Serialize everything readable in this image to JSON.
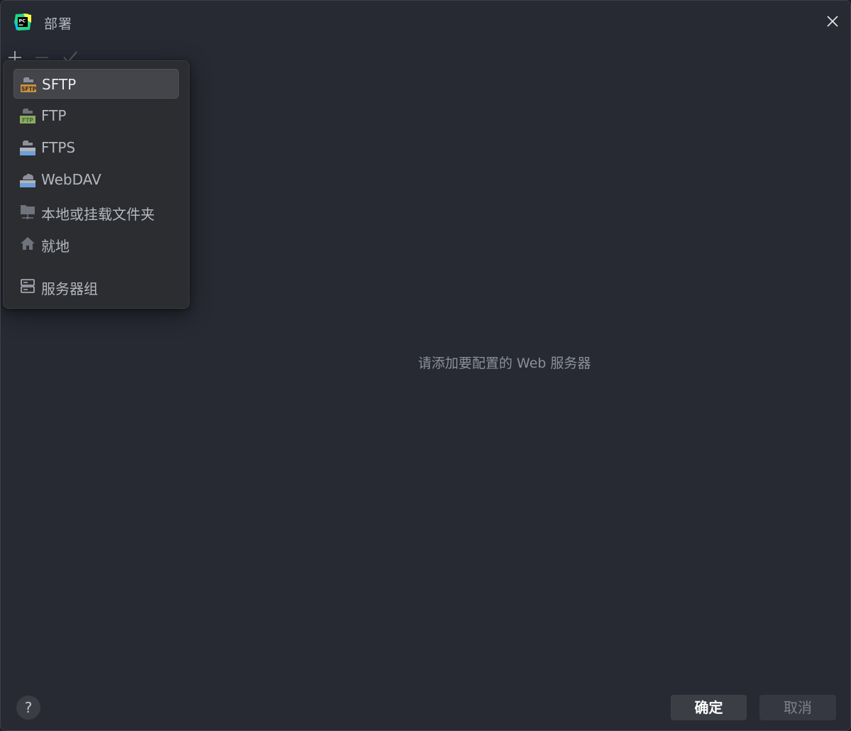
{
  "window": {
    "title": "部署",
    "app_logo_text": "PC"
  },
  "toolbar": {
    "add_icon": "plus-icon",
    "remove_icon": "minus-icon",
    "apply_icon": "check-icon"
  },
  "popup": {
    "items": [
      {
        "label": "SFTP",
        "icon": "sftp-icon",
        "icon_badge": "SFTP",
        "selected": true
      },
      {
        "label": "FTP",
        "icon": "ftp-icon",
        "icon_badge": "FTP"
      },
      {
        "label": "FTPS",
        "icon": "ftps-icon"
      },
      {
        "label": "WebDAV",
        "icon": "webdav-icon"
      },
      {
        "label": "本地或挂载文件夹",
        "icon": "local-folder-icon"
      },
      {
        "label": "就地",
        "icon": "home-icon"
      },
      {
        "label": "服务器组",
        "icon": "server-group-icon"
      }
    ]
  },
  "main": {
    "empty_message": "请添加要配置的 Web 服务器"
  },
  "footer": {
    "help_label": "?",
    "ok_label": "确定",
    "cancel_label": "取消"
  },
  "colors": {
    "background": "#272a33",
    "popup_bg": "#2b2d30",
    "selected_bg": "#43454a",
    "sftp_badge": "#c98f3b",
    "ftp_badge": "#8aab63",
    "ftps_accent": "#6f9fd8",
    "logo_green": "#21d789",
    "logo_yellow": "#fcf84a"
  }
}
